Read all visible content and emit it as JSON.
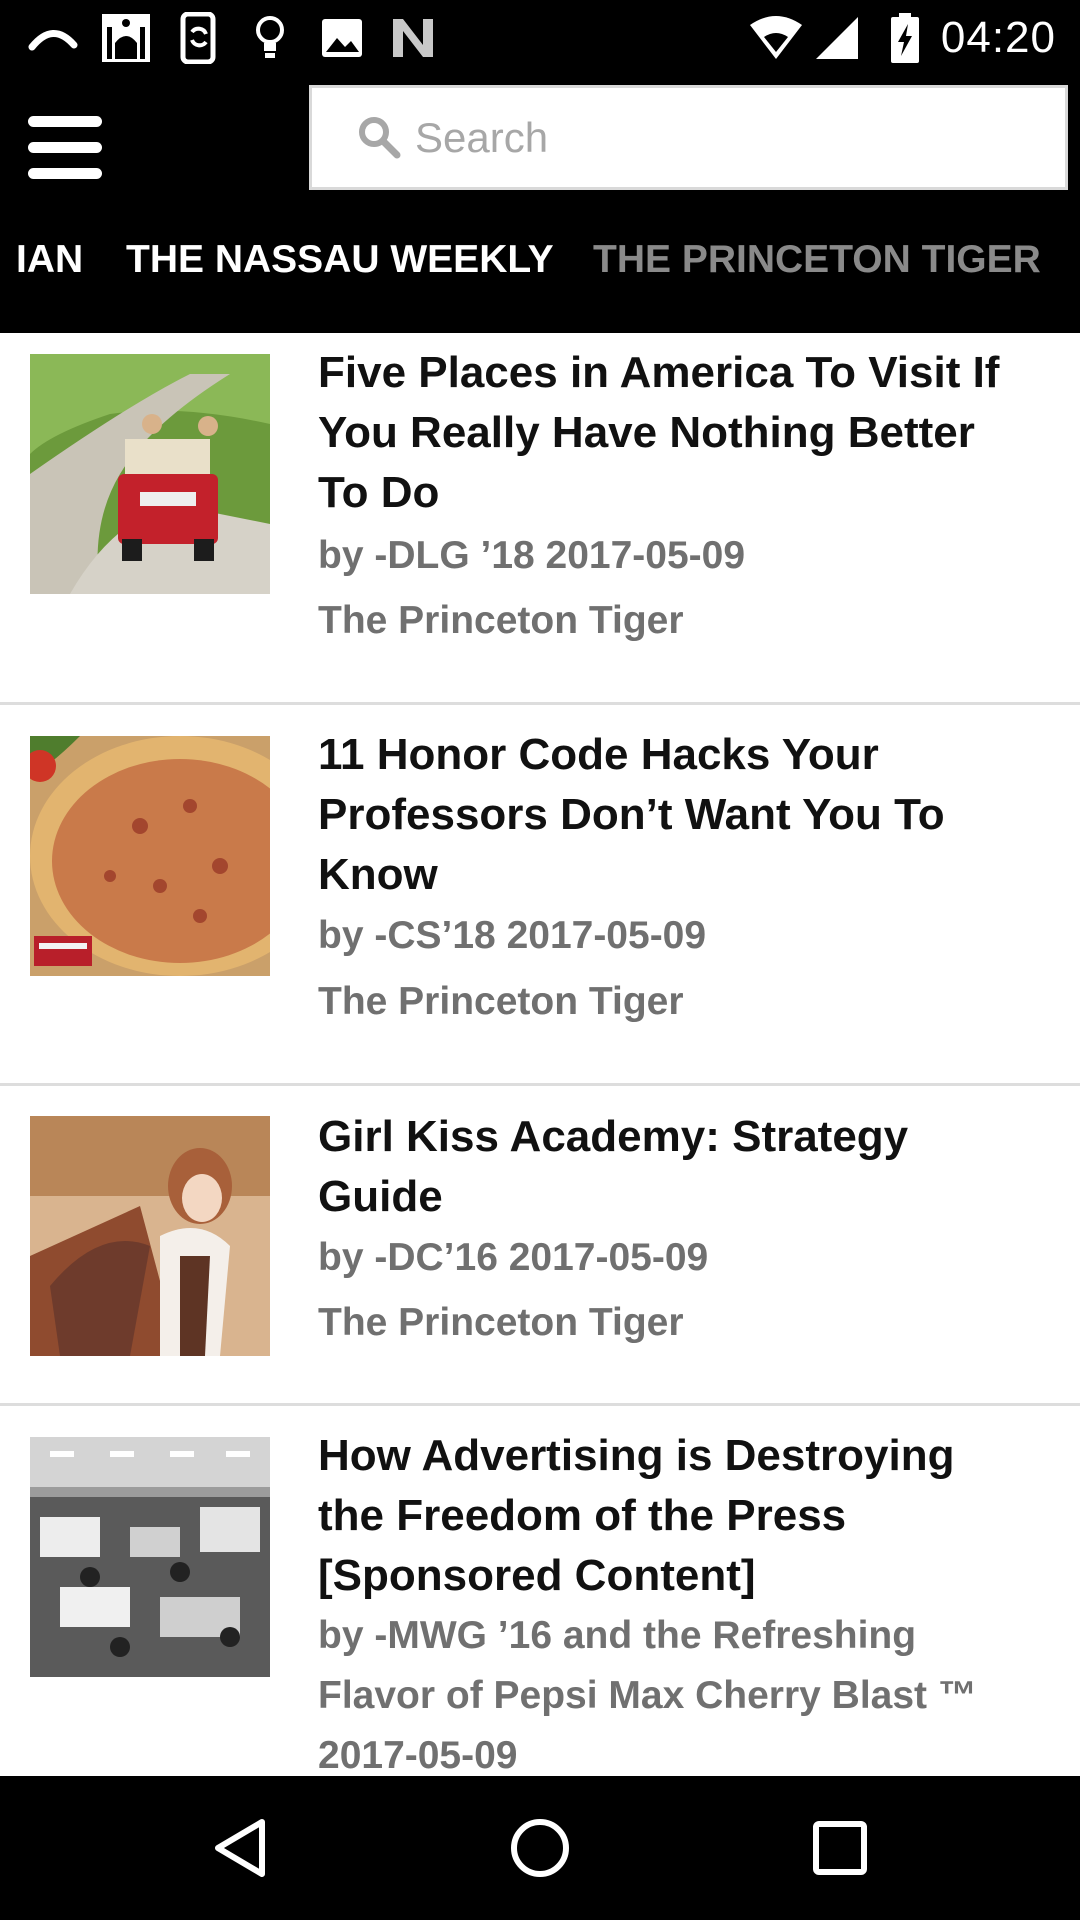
{
  "status_bar": {
    "time": "04:20",
    "left_icons": [
      "curved-line-icon",
      "mosque-icon",
      "phone-sync-icon",
      "lightbulb-icon",
      "image-icon",
      "n-logo-icon"
    ],
    "right_icons": [
      "wifi-icon",
      "signal-icon",
      "battery-charging-icon"
    ]
  },
  "header": {
    "search": {
      "placeholder": "Search",
      "value": ""
    },
    "tabs": [
      {
        "label": "IAN",
        "selected": false
      },
      {
        "label": "THE NASSAU WEEKLY",
        "selected": true
      },
      {
        "label": "THE PRINCETON TIGER",
        "selected": false
      }
    ]
  },
  "articles": [
    {
      "title_lines": [
        "Five Places in America To Visit If",
        "You Really Have Nothing Better",
        "To Do"
      ],
      "byline_lines": [
        "by -DLG ’18 2017-05-09"
      ],
      "publication": "The Princeton Tiger",
      "thumbnail": "road-trip-car-photo"
    },
    {
      "title_lines": [
        "11 Honor Code Hacks Your",
        "Professors Don’t Want You To",
        "Know"
      ],
      "byline_lines": [
        "by -CS’18 2017-05-09"
      ],
      "publication": "The Princeton Tiger",
      "thumbnail": "pizza-photo"
    },
    {
      "title_lines": [
        "Girl Kiss Academy: Strategy",
        "Guide"
      ],
      "byline_lines": [
        "by -DC’16 2017-05-09"
      ],
      "publication": "The Princeton Tiger",
      "thumbnail": "anime-girl-illustration"
    },
    {
      "title_lines": [
        "How Advertising is Destroying",
        "the Freedom of the Press",
        "[Sponsored Content]"
      ],
      "byline_lines": [
        "by -MWG ’16 and the Refreshing",
        "Flavor of Pepsi Max Cherry Blast ™",
        "2017-05-09"
      ],
      "publication": "",
      "thumbnail": "newsroom-bw-photo"
    }
  ],
  "nav_bar": {
    "buttons": [
      "back-icon",
      "home-icon",
      "recents-icon"
    ]
  },
  "colors": {
    "header_bg": "#000000",
    "title_text": "#111111",
    "meta_text": "#707070",
    "tab_active": "#ffffff",
    "tab_inactive": "#8a8a8a",
    "divider": "#dddddd"
  }
}
